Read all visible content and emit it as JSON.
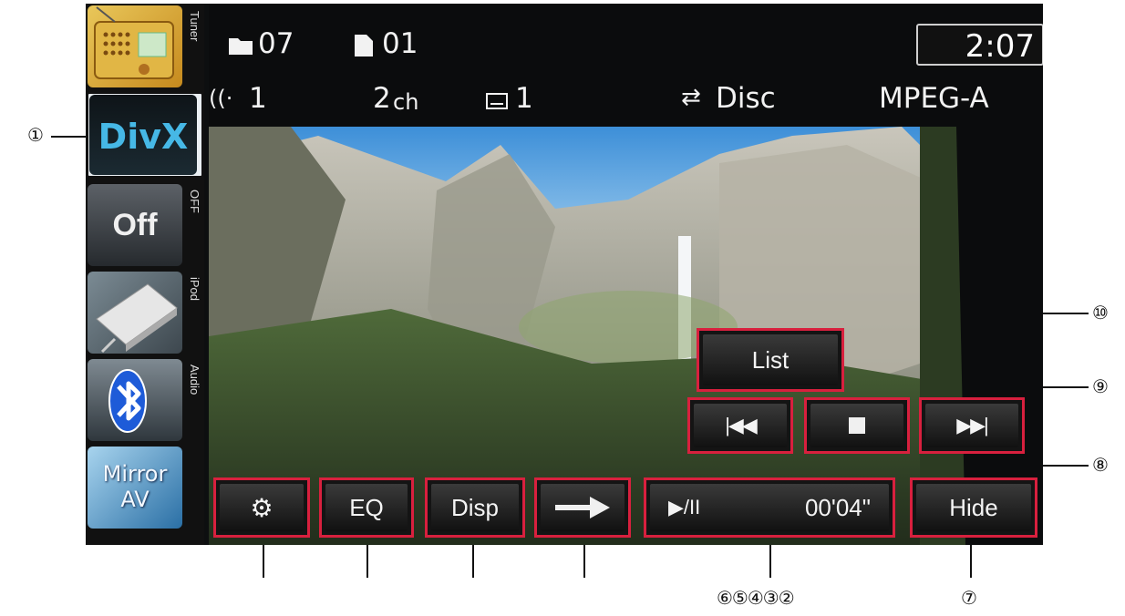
{
  "status": {
    "folder": "07",
    "file": "01",
    "time": "2:07",
    "audio_track": "1",
    "channels": "2",
    "channels_unit": "ch",
    "subtitle": "1",
    "repeat": "Disc",
    "audio_format": "MPEG-A"
  },
  "sources": [
    {
      "tab": "Tuner"
    },
    {
      "label": "DivX"
    },
    {
      "label": "Off",
      "tab": "OFF"
    },
    {
      "tab": "iPod"
    },
    {
      "tab": "Audio"
    },
    {
      "label": "Mirror AV"
    }
  ],
  "controls": {
    "list": "List",
    "eq": "EQ",
    "disp": "Disp",
    "play_pause": "▶/II",
    "elapsed": "00'04\"",
    "hide": "Hide"
  },
  "callouts": {
    "c1": "①",
    "c2": "⑥⑤④③②",
    "c7": "⑦",
    "c8": "⑧",
    "c9": "⑨",
    "c10": "⑩"
  }
}
